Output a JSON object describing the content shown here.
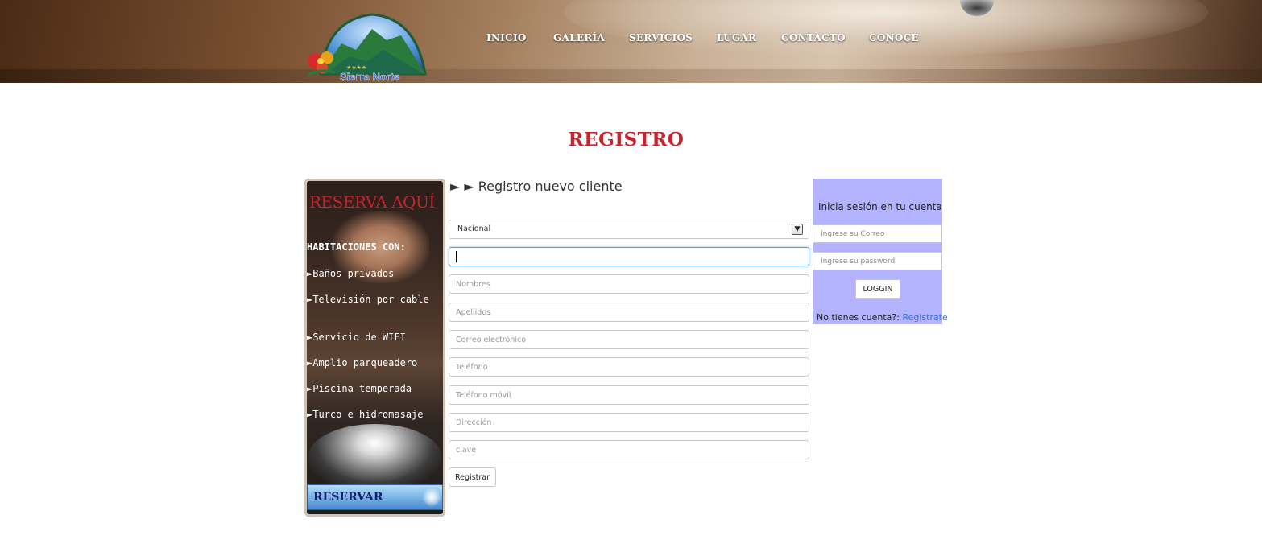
{
  "brand": {
    "logo_text": "Sierra Norte",
    "stars": "★★★★"
  },
  "nav": [
    "INICIO",
    "GALERÍA",
    "SERVICIOS",
    "LUGAR",
    "CONTACTO",
    "CONOCE"
  ],
  "page_title": "REGISTRO",
  "promo": {
    "title": "RESERVA AQUÍ",
    "subtitle": "HABITACIONES CON:",
    "features": [
      "►Baños privados",
      "►Televisión por cable",
      "►Servicio de WIFI",
      "►Amplio parqueadero",
      "►Piscina temperada",
      "►Turco e hidromasaje"
    ],
    "button_label": "RESERVAR"
  },
  "register": {
    "heading": "► ► Registro nuevo cliente",
    "select_value": "Nacional",
    "placeholders": {
      "nombres": "Nombres",
      "apellidos": "Apellidos",
      "correo": "Correo electrónico",
      "telefono": "Teléfono",
      "movil": "Teléfono móvil",
      "direccion": "Dirección",
      "clave": "clave"
    },
    "submit_label": "Registrar"
  },
  "login": {
    "title": "Inicia sesión en tu cuenta",
    "email_placeholder": "Ingrese su Correo",
    "password_placeholder": "Ingrese su password",
    "button_label": "LOGGIN",
    "no_account_text": "No tienes cuenta?: ",
    "register_link": "Registrate"
  },
  "colors": {
    "title_red": "#c4262e",
    "login_bg": "#b3b3ff",
    "link_blue": "#3a6fd8"
  }
}
